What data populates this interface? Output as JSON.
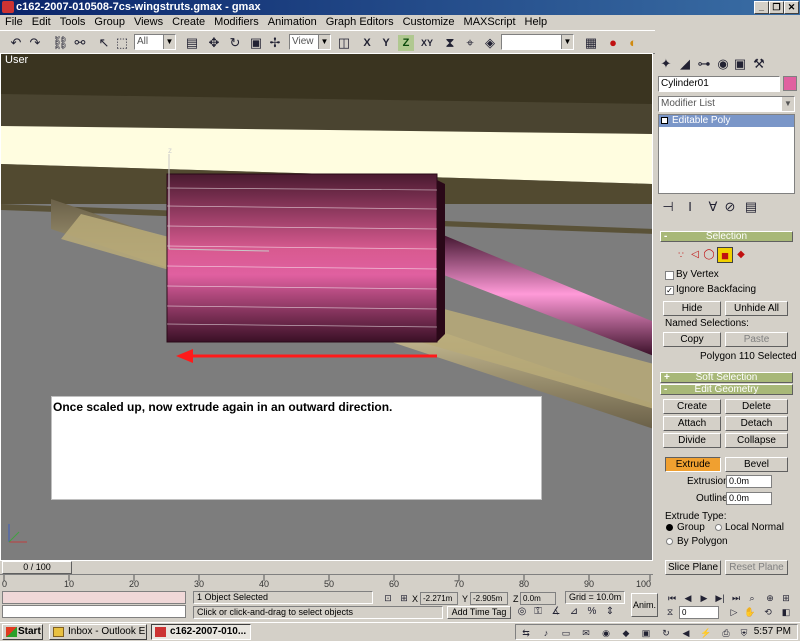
{
  "window": {
    "title": "c162-2007-010508-7cs-wingstruts.gmax - gmax",
    "controls": [
      "_",
      "❐",
      "✕"
    ]
  },
  "menu": [
    "File",
    "Edit",
    "Tools",
    "Group",
    "Views",
    "Create",
    "Modifiers",
    "Animation",
    "Graph Editors",
    "Customize",
    "MAXScript",
    "Help"
  ],
  "toolbar": {
    "selection_filter": "All",
    "reference_coord": "View",
    "axis_buttons": [
      "X",
      "Y",
      "Z",
      "XY"
    ],
    "named_selection": ""
  },
  "viewport": {
    "label": "User",
    "gizmo_axis": "z",
    "overlay_text": "Once scaled up, now extrude again in an outward direction.",
    "colors": {
      "accent_arrow": "#ff1a1a",
      "cylinder": "#d05088",
      "strut": "#c8b98a",
      "wing": "#fffde0"
    }
  },
  "command_panel": {
    "object_name": "Cylinder01",
    "object_color": "#e060a0",
    "modifier_list": "Modifier List",
    "stack": [
      "Editable Poly"
    ],
    "selection": {
      "title": "Selection",
      "by_vertex": "By Vertex",
      "by_vertex_checked": false,
      "ignore_backfacing": "Ignore Backfacing",
      "ignore_backfacing_checked": true,
      "hide": "Hide",
      "unhide_all": "Unhide All",
      "named_selections": "Named Selections:",
      "copy": "Copy",
      "paste": "Paste",
      "status": "Polygon 110 Selected"
    },
    "soft_selection": "Soft Selection",
    "edit_geometry": {
      "title": "Edit Geometry",
      "buttons": [
        "Create",
        "Delete",
        "Attach",
        "Detach",
        "Divide",
        "Collapse"
      ],
      "extrude": "Extrude",
      "bevel": "Bevel",
      "extrusion_label": "Extrusion:",
      "extrusion_value": "0.0m",
      "outline_label": "Outline",
      "outline_value": "0.0m",
      "extrude_type": "Extrude Type:",
      "group": "Group",
      "local_normal": "Local Normal",
      "by_polygon": "By Polygon",
      "slice_plane": "Slice Plane",
      "reset_plane": "Reset Plane"
    }
  },
  "timeline": {
    "frame_label": "0 / 100",
    "ticks": [
      "0",
      "10",
      "20",
      "30",
      "40",
      "50",
      "60",
      "70",
      "80",
      "90",
      "100"
    ]
  },
  "status": {
    "selected": "1 Object Selected",
    "prompt": "Click or click-and-drag to select objects",
    "x_label": "X",
    "x_value": "-2.271m",
    "y_label": "Y",
    "y_value": "-2.905m",
    "z_label": "Z",
    "z_value": "0.0m",
    "grid": "Grid = 10.0m",
    "add_time_tag": "Add Time Tag",
    "anim": "Anim.",
    "frame": "0"
  },
  "taskbar": {
    "start": "Start",
    "tasks": [
      "Inbox - Outlook E...",
      "c162-2007-010..."
    ],
    "clock": "5:57 PM"
  }
}
